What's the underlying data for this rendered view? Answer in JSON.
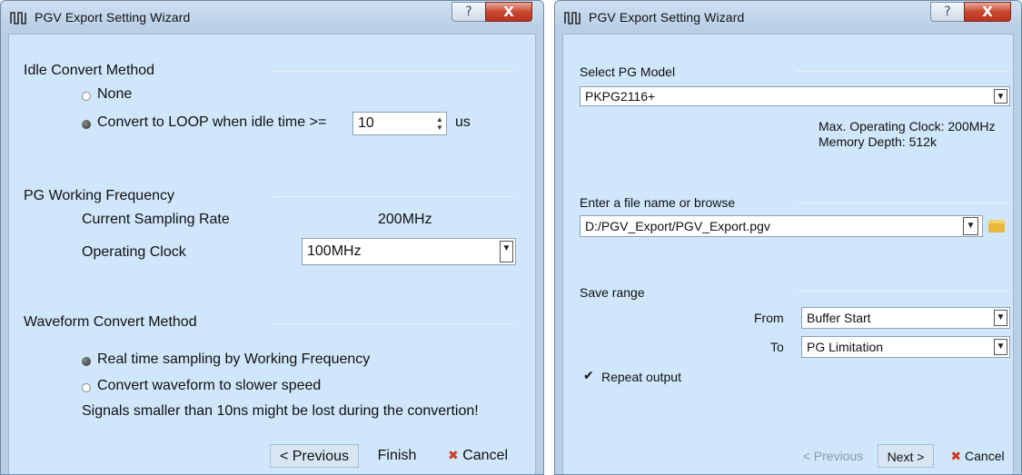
{
  "left_wizard": {
    "title": "PGV Export Setting Wizard",
    "titlebar": {
      "help_symbol": "?",
      "close_symbol": "X"
    },
    "idle_convert": {
      "heading": "Idle Convert Method",
      "option_none": "None",
      "option_loop": "Convert to LOOP when idle time >=",
      "selected": "loop",
      "idle_time_value": "10",
      "idle_time_unit": "us"
    },
    "pg_working_frequency": {
      "heading": "PG Working Frequency",
      "sampling_rate_label": "Current Sampling Rate",
      "sampling_rate_value": "200MHz",
      "operating_clock_label": "Operating Clock",
      "operating_clock_value": "100MHz"
    },
    "waveform_convert": {
      "heading": "Waveform Convert Method",
      "option_realtime": "Real time sampling by Working Frequency",
      "option_slower": "Convert waveform to slower speed",
      "selected": "realtime",
      "warning": "Signals smaller than 10ns might be lost during the convertion!"
    },
    "buttons": {
      "previous": "< Previous",
      "finish": "Finish",
      "cancel": "Cancel"
    }
  },
  "right_wizard": {
    "title": "PGV Export Setting Wizard",
    "titlebar": {
      "help_symbol": "?",
      "close_symbol": "X"
    },
    "pg_model": {
      "heading": "Select PG Model",
      "selected_model": "PKPG2116+",
      "max_clock": "Max. Operating Clock: 200MHz",
      "memory_depth": "Memory Depth: 512k"
    },
    "file": {
      "heading": "Enter a file name or browse",
      "path": "D:/PGV_Export/PGV_Export.pgv"
    },
    "save_range": {
      "heading": "Save range",
      "from_label": "From",
      "from_value": "Buffer Start",
      "to_label": "To",
      "to_value": "PG Limitation"
    },
    "repeat_output": {
      "label": "Repeat output",
      "checked": true
    },
    "buttons": {
      "previous": "< Previous",
      "next": "Next >",
      "cancel": "Cancel"
    }
  },
  "icons": {
    "app_icon": "waveform-icon",
    "radio_on": "radio-selected-icon",
    "radio_off": "radio-unselected-icon",
    "dropdown": "chevron-down-icon",
    "spinner": "spinner-arrows-icon",
    "folder": "folder-icon",
    "cancel": "x-icon",
    "check": "checkmark-icon"
  },
  "colors": {
    "client_bg": "#cfe6fb",
    "frame_bg": "#b9cfe6",
    "close_button": "#c9472f",
    "cancel_x": "#d23a25",
    "disabled_text": "#8f9aa6"
  }
}
